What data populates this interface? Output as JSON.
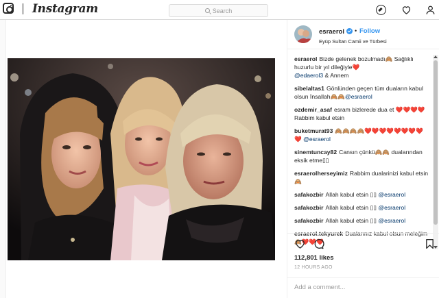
{
  "topbar": {
    "wordmark": "Instagram",
    "search_placeholder": "Search",
    "icons": [
      "camera-logo-icon",
      "compass-icon",
      "heart-icon",
      "profile-icon"
    ]
  },
  "post": {
    "username": "esraerol",
    "follow_label": "Follow",
    "location": "Eyüp Sultan Camii ve Türbesi",
    "comments": [
      {
        "user": "esraerol",
        "text": "Bizde gelenek bozulmadı🙈 Sağlıklı huzurlu bir yıl dileğiyle❤️",
        "mention": "@edaerol3",
        "after": " & Annem"
      },
      {
        "user": "sibelaltas1",
        "text": "Gönlünden geçen tüm duaların kabul olsun İnsallah🙈🙈",
        "mention": "@esraerol",
        "after": ""
      },
      {
        "user": "ozdemir_asaf",
        "text": "esram bizlerede dua et ❤️❤️❤️❤️ Rabbim kabul etsin",
        "mention": "",
        "after": ""
      },
      {
        "user": "buketmurat93",
        "text": "🙈🙈🙈🙈❤️❤️❤️❤️❤️❤️❤️❤️❤️",
        "mention": "@esraerol",
        "after": ""
      },
      {
        "user": "sinemtuncay82",
        "text": "Cansın çünkü🙈🙈 dualarından eksik etme▯▯",
        "mention": "",
        "after": ""
      },
      {
        "user": "esraerolherseyimiz",
        "text": "Rabbim dualarinizi kabul etsin🙈",
        "mention": "",
        "after": ""
      },
      {
        "user": "safakozbir",
        "text": "Allah kabul etsin ▯▯",
        "mention": "@esraerol",
        "after": ""
      },
      {
        "user": "safakozbir",
        "text": "Allah kabul etsin ▯▯",
        "mention": "@esraerol",
        "after": ""
      },
      {
        "user": "safakozbir",
        "text": "Allah kabul etsin ▯▯",
        "mention": "@esraerol",
        "after": ""
      },
      {
        "user": "esraerol.tekyurek",
        "text": "Dualarınız kabul olsun meleğim🙈❤️❤️❤️",
        "mention": "",
        "after": ""
      }
    ],
    "likes": "112,801 likes",
    "timestamp": "12 HOURS AGO",
    "add_comment_placeholder": "Add a comment..."
  },
  "colors": {
    "accent": "#3897f0",
    "border": "#dbdbdb",
    "text": "#262626",
    "muted": "#999999"
  }
}
